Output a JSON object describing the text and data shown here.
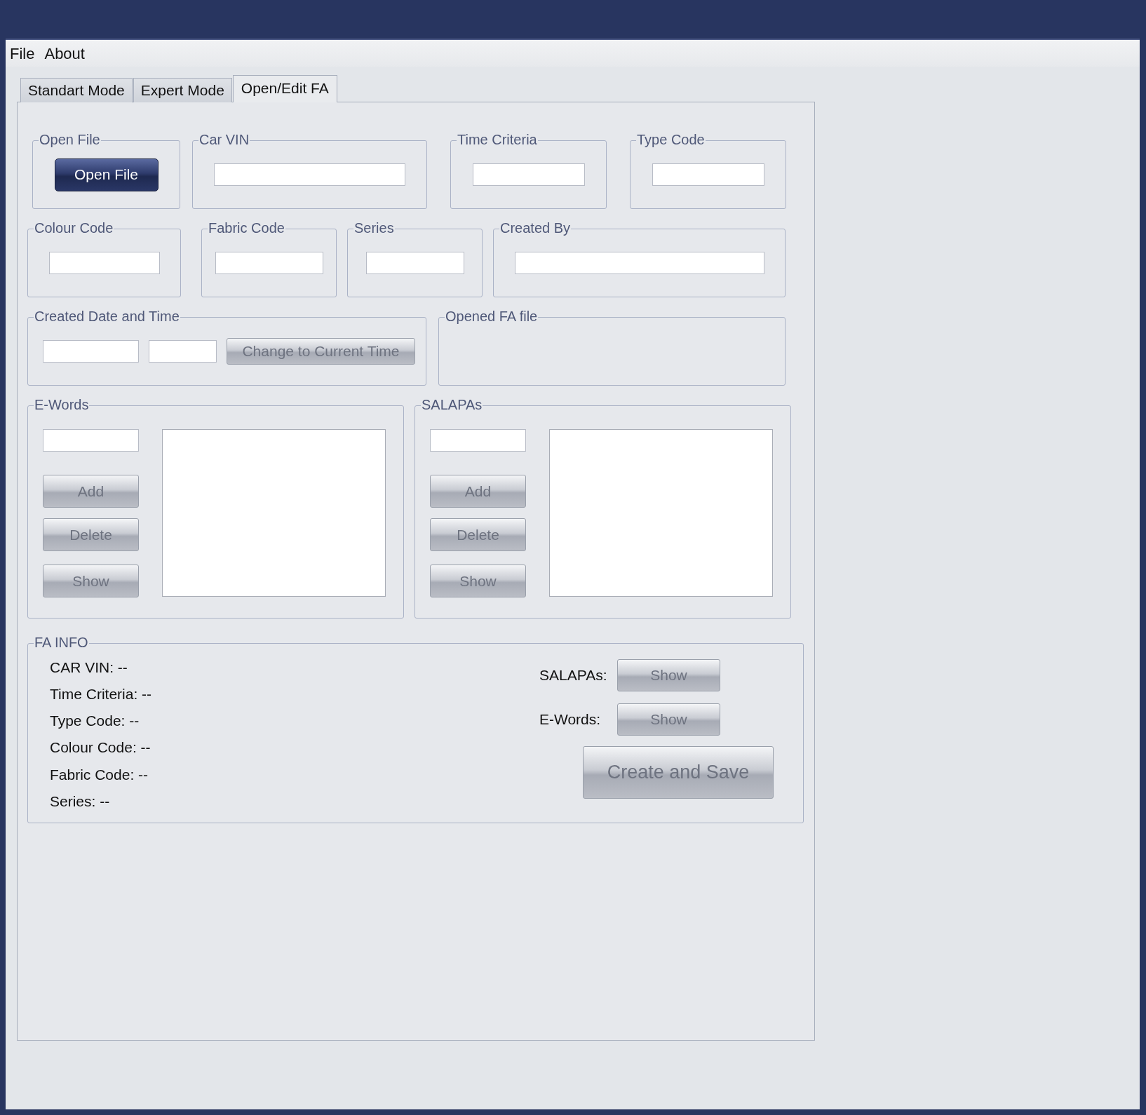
{
  "menu": [
    "File",
    "About"
  ],
  "tabs": [
    {
      "label": "Standart Mode",
      "selected": false
    },
    {
      "label": "Expert Mode",
      "selected": false
    },
    {
      "label": "Open/Edit FA",
      "selected": true
    }
  ],
  "field_groups": [
    {
      "legend": "Open File",
      "kind": "button",
      "button": {
        "label": "Open File",
        "disabled": false
      }
    },
    {
      "legend": "Car VIN",
      "kind": "input"
    },
    {
      "legend": "Time Criteria",
      "kind": "input"
    },
    {
      "legend": "Type Code",
      "kind": "input"
    },
    {
      "legend": "Colour Code",
      "kind": "input"
    },
    {
      "legend": "Fabric Code",
      "kind": "input"
    },
    {
      "legend": "Series",
      "kind": "input"
    },
    {
      "legend": "Created By",
      "kind": "input"
    },
    {
      "legend": "Created Date and Time",
      "kind": "datetime",
      "button": {
        "label": "Change to Current Time",
        "disabled": true
      }
    },
    {
      "legend": "Opened FA file",
      "kind": "empty"
    }
  ],
  "list_groups": [
    {
      "legend": "E-Words",
      "buttons": [
        {
          "label": "Add",
          "disabled": true
        },
        {
          "label": "Delete",
          "disabled": true
        },
        {
          "label": "Show",
          "disabled": true
        }
      ]
    },
    {
      "legend": "SALAPAs",
      "buttons": [
        {
          "label": "Add",
          "disabled": true
        },
        {
          "label": "Delete",
          "disabled": true
        },
        {
          "label": "Show",
          "disabled": true
        }
      ]
    }
  ],
  "fa_info": {
    "legend": "FA INFO",
    "lines": [
      "CAR VIN: --",
      "Time Criteria: --",
      "Type Code: --",
      "Colour Code: --",
      "Fabric Code: --",
      "Series: --"
    ],
    "show_rows": [
      {
        "label": "SALAPAs:",
        "button": {
          "label": "Show",
          "disabled": true
        }
      },
      {
        "label": "E-Words:",
        "button": {
          "label": "Show",
          "disabled": true
        }
      }
    ],
    "create_button": {
      "label": "Create and Save",
      "disabled": true
    }
  }
}
